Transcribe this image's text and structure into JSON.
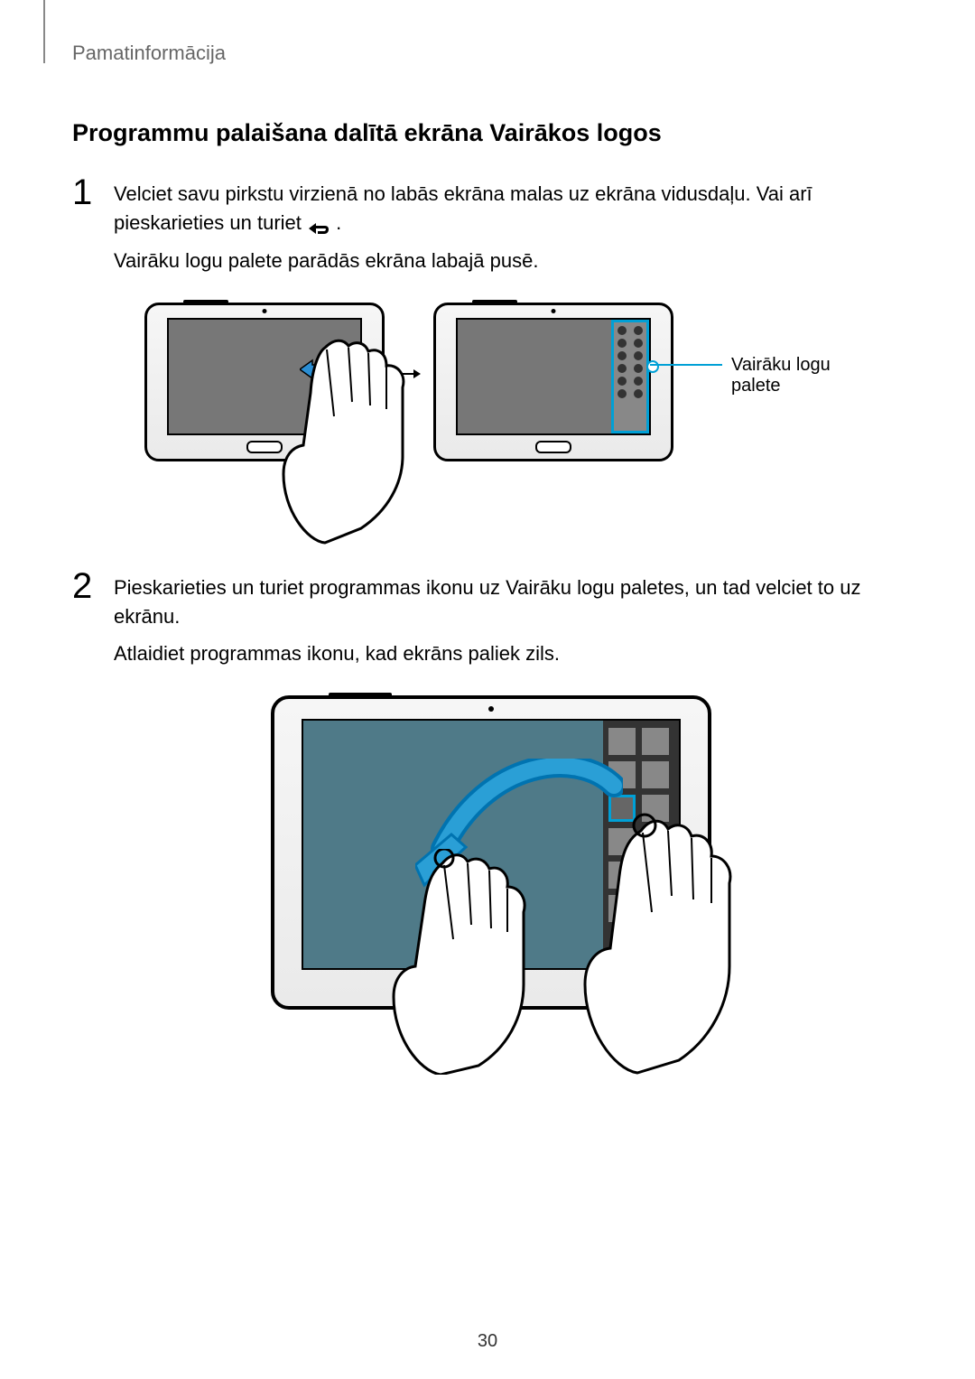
{
  "header": {
    "section": "Pamatinformācija"
  },
  "title": "Programmu palaišana dalītā ekrāna Vairākos logos",
  "steps": [
    {
      "num": "1",
      "para1_a": "Velciet savu pirkstu virzienā no labās ekrāna malas uz ekrāna vidusdaļu. Vai arī pieskarieties un turiet ",
      "para1_b": ".",
      "para2": "Vairāku logu palete parādās ekrāna labajā pusē."
    },
    {
      "num": "2",
      "para1": "Pieskarieties un turiet programmas ikonu uz Vairāku logu paletes, un tad velciet to uz ekrānu.",
      "para2": "Atlaidiet programmas ikonu, kad ekrāns paliek zils."
    }
  ],
  "callout": "Vairāku logu palete",
  "page_number": "30"
}
